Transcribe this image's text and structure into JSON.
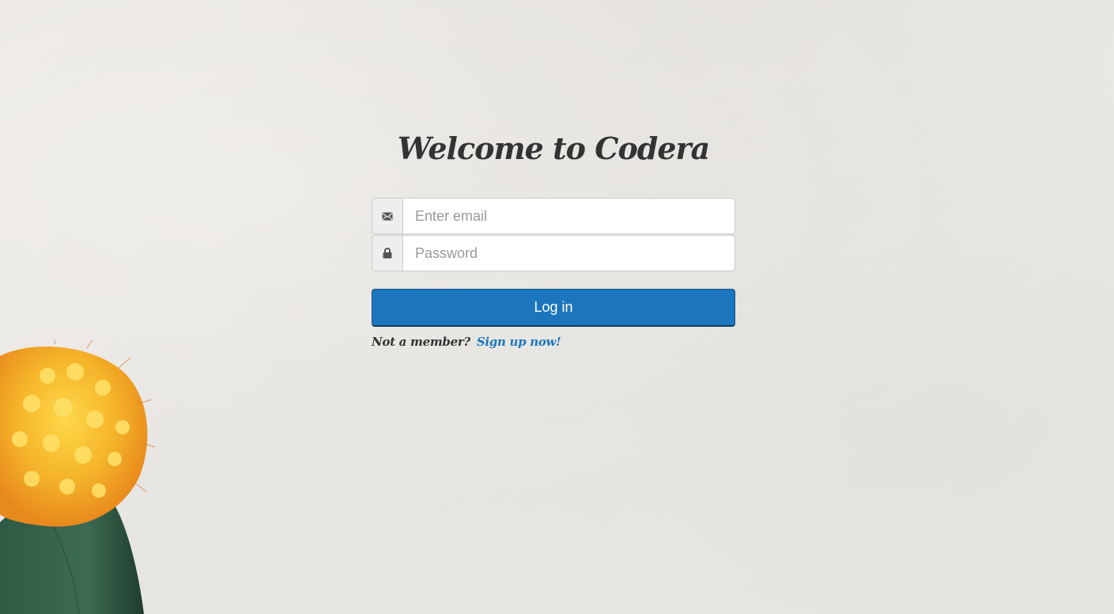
{
  "page": {
    "title": "Welcome to Codera"
  },
  "login_form": {
    "email": {
      "icon": "envelope-icon",
      "placeholder": "Enter email",
      "value": ""
    },
    "password": {
      "icon": "lock-icon",
      "placeholder": "Password",
      "value": ""
    },
    "submit_label": "Log in",
    "member_prompt": "Not a member?",
    "signup_link": "Sign up now!"
  },
  "colors": {
    "accent": "#1b76be",
    "title_text": "#333333",
    "background": "#e8e6e2"
  },
  "decoration": {
    "image": "cactus-flower"
  }
}
